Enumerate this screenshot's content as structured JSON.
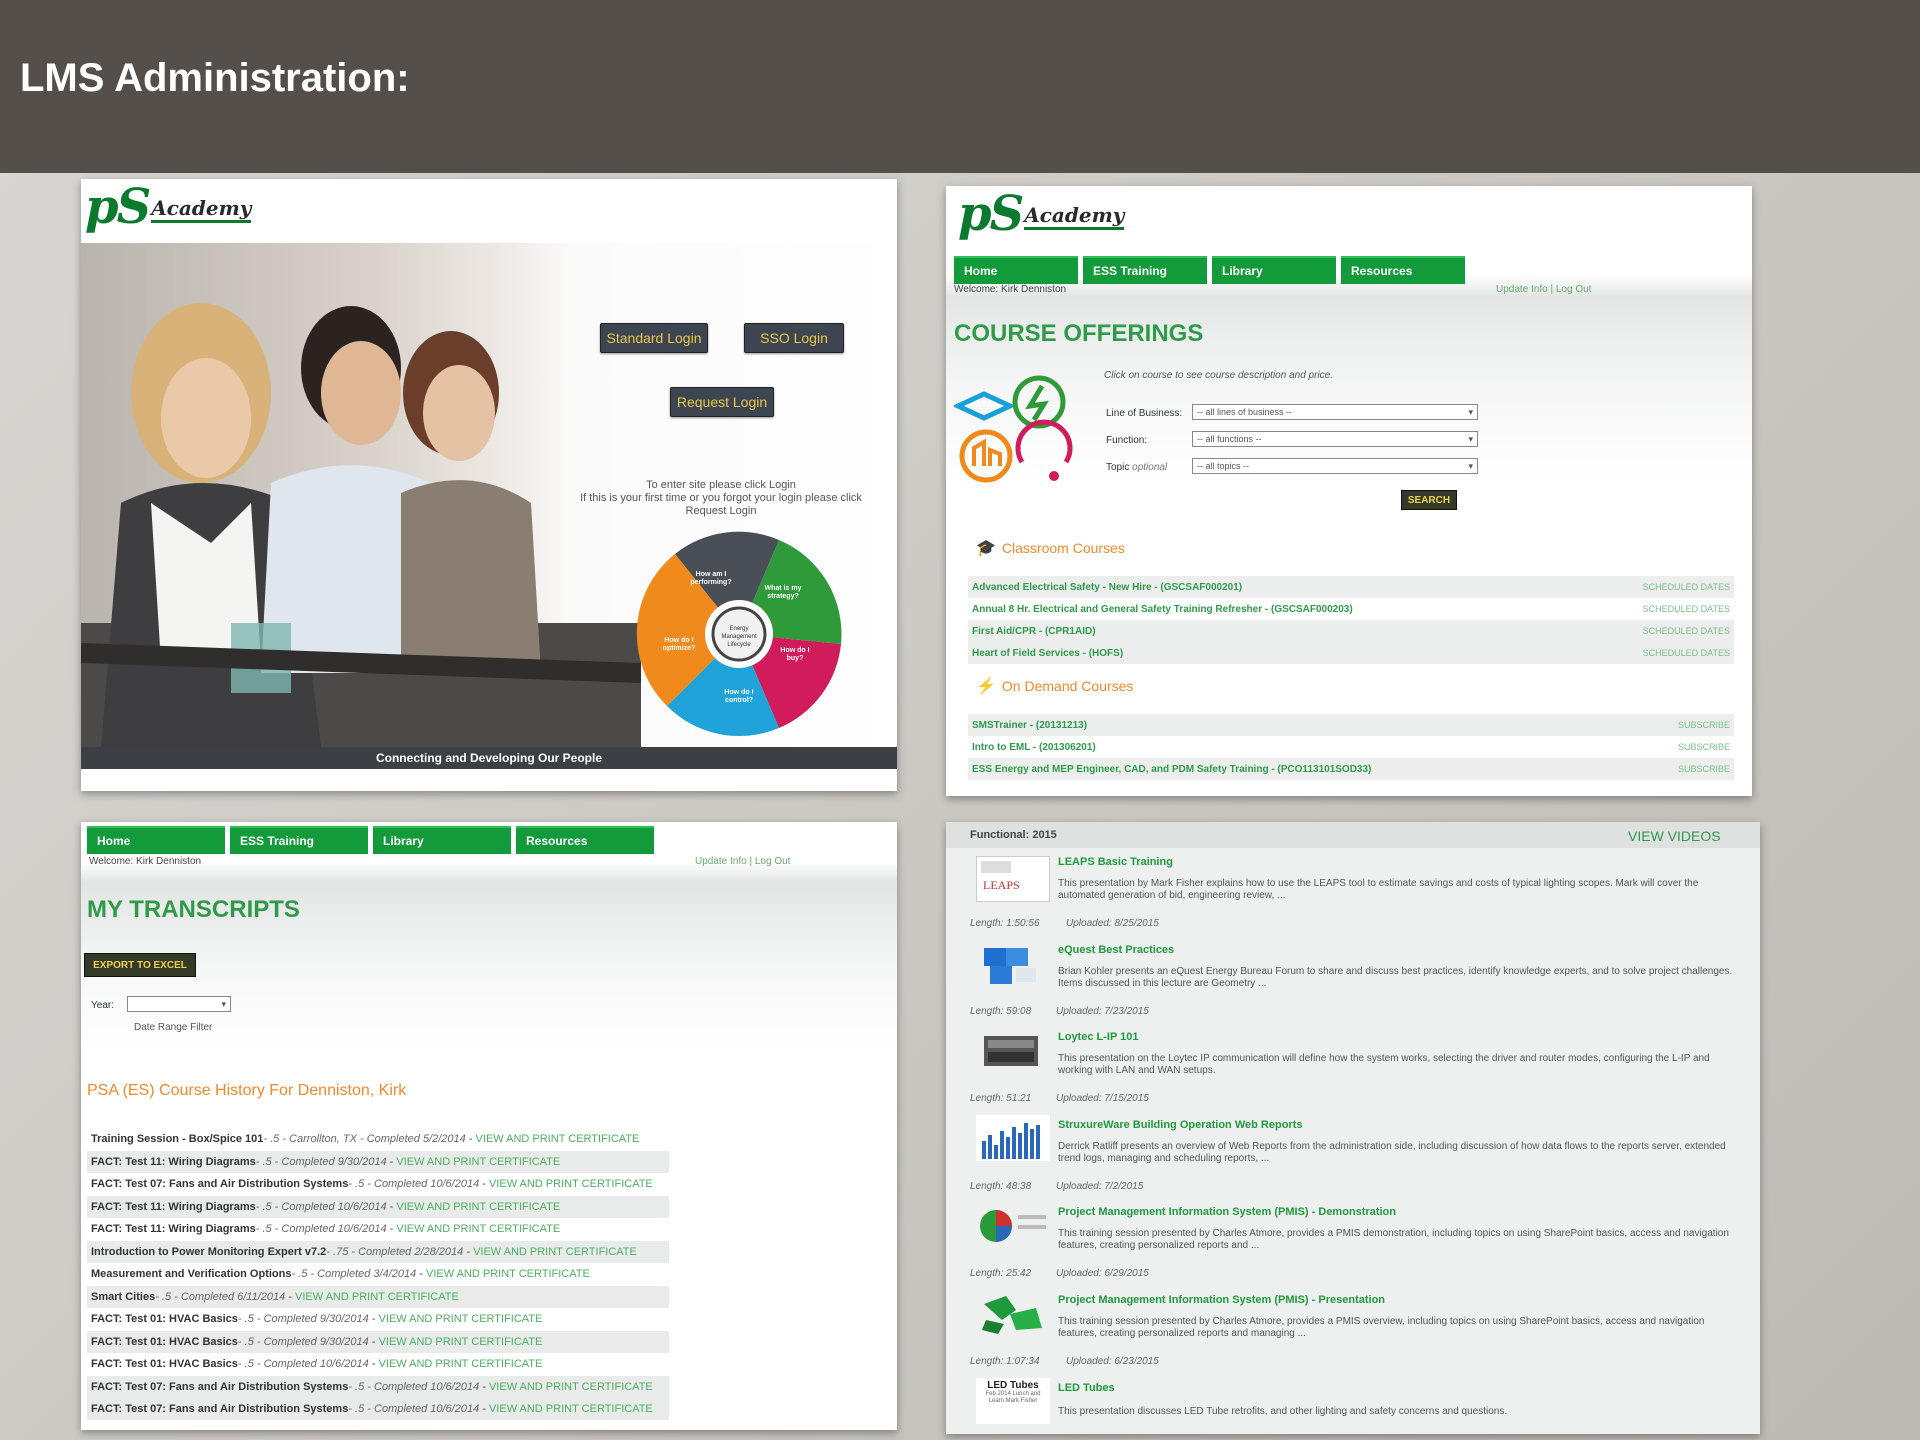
{
  "slide": {
    "title": "LMS Administration:"
  },
  "brand": {
    "ps": "pS",
    "academy": "Academy"
  },
  "login": {
    "standard": "Standard Login",
    "sso": "SSO Login",
    "request": "Request Login",
    "msg1": "To enter site please click Login",
    "msg2": "If this is your first time or you forgot your login please click",
    "msg3": "Request Login",
    "wheel": {
      "center": "Energy Management Lifecycle",
      "q1": "How am I performing?",
      "q2": "What is my strategy?",
      "q3": "How do I buy?",
      "q4": "How do I control?",
      "q5": "How do I optimize?"
    },
    "footer": "Connecting and Developing Our People"
  },
  "nav": {
    "home": "Home",
    "ess": "ESS Training",
    "library": "Library",
    "resources": "Resources"
  },
  "user": {
    "welcome": "Welcome: Kirk Denniston",
    "links": "Update Info | Log Out"
  },
  "offerings": {
    "title": "COURSE OFFERINGS",
    "hint": "Click on course to see course description and price.",
    "lob_label": "Line of Business:",
    "lob_value": "-- all lines of business --",
    "func_label": "Function:",
    "func_value": "-- all functions --",
    "topic_label": "Topic",
    "topic_opt": "optional",
    "topic_value": "-- all topics --",
    "search": "SEARCH",
    "classroom_title": "Classroom Courses",
    "classroom": [
      {
        "name": "Advanced Electrical Safety - New Hire - (GSCSAF000201)",
        "action": "SCHEDULED DATES"
      },
      {
        "name": "Annual 8 Hr. Electrical and General Safety Training Refresher - (GSCSAF000203)",
        "action": "SCHEDULED DATES"
      },
      {
        "name": "First Aid/CPR - (CPR1AID)",
        "action": "SCHEDULED DATES"
      },
      {
        "name": "Heart of Field Services - (HOFS)",
        "action": "SCHEDULED DATES"
      }
    ],
    "ondemand_title": "On Demand Courses",
    "ondemand": [
      {
        "name": "SMSTrainer - (20131213)",
        "action": "SUBSCRIBE"
      },
      {
        "name": "Intro to EML - (201306201)",
        "action": "SUBSCRIBE"
      },
      {
        "name": "ESS Energy and MEP Engineer, CAD, and PDM Safety Training - (PCO113101SOD33)",
        "action": "SUBSCRIBE"
      }
    ]
  },
  "transcripts": {
    "title": "MY TRANSCRIPTS",
    "export": "EXPORT TO EXCEL",
    "year_label": "Year:",
    "range": "Date Range Filter",
    "history": "PSA (ES) Course History For Denniston, Kirk",
    "rows": [
      {
        "name": "Training Session - Box/Spice 101",
        "meta": " - .5 - Carrollton, TX - Completed 5/2/2014",
        "cert": "VIEW AND PRINT CERTIFICATE"
      },
      {
        "name": "FACT: Test 11: Wiring Diagrams",
        "meta": " - .5 - Completed 9/30/2014",
        "cert": "VIEW AND PRINT CERTIFICATE"
      },
      {
        "name": "FACT: Test 07: Fans and Air Distribution Systems",
        "meta": " - .5 - Completed 10/6/2014",
        "cert": "VIEW AND PRINT CERTIFICATE"
      },
      {
        "name": "FACT: Test 11: Wiring Diagrams",
        "meta": " - .5 - Completed 10/6/2014",
        "cert": "VIEW AND PRINT CERTIFICATE"
      },
      {
        "name": "FACT: Test 11: Wiring Diagrams",
        "meta": " - .5 - Completed 10/6/2014",
        "cert": "VIEW AND PRINT CERTIFICATE"
      },
      {
        "name": "Introduction to Power Monitoring Expert v7.2",
        "meta": " - .75 - Completed 2/28/2014",
        "cert": "VIEW AND PRINT CERTIFICATE"
      },
      {
        "name": "Measurement and Verification Options",
        "meta": " - .5 - Completed 3/4/2014",
        "cert": "VIEW AND PRINT CERTIFICATE"
      },
      {
        "name": "Smart Cities",
        "meta": " - .5 - Completed 6/11/2014",
        "cert": "VIEW AND PRINT CERTIFICATE"
      },
      {
        "name": "FACT: Test 01: HVAC Basics",
        "meta": " - .5 - Completed 9/30/2014",
        "cert": "VIEW AND PRINT CERTIFICATE"
      },
      {
        "name": "FACT: Test 01: HVAC Basics",
        "meta": " - .5 - Completed 9/30/2014",
        "cert": "VIEW AND PRINT CERTIFICATE"
      },
      {
        "name": "FACT: Test 01: HVAC Basics",
        "meta": " - .5 - Completed 10/6/2014",
        "cert": "VIEW AND PRINT CERTIFICATE"
      },
      {
        "name": "FACT: Test 07: Fans and Air Distribution Systems",
        "meta": " - .5 - Completed 10/6/2014",
        "cert": "VIEW AND PRINT CERTIFICATE"
      },
      {
        "name": "FACT: Test 07: Fans and Air Distribution Systems",
        "meta": " - .5 - Completed 10/6/2014",
        "cert": "VIEW AND PRINT CERTIFICATE"
      }
    ]
  },
  "videos": {
    "header": "Functional: 2015",
    "view": "VIEW VIDEOS",
    "items": [
      {
        "title": "LEAPS Basic Training",
        "desc": "This presentation by Mark Fisher explains how to use the LEAPS tool to estimate savings and costs of typical lighting scopes. Mark will cover the automated generation of bid, engineering review, ...",
        "length": "Length: 1:50:56",
        "uploaded": "Uploaded: 8/25/2015",
        "thumb": "leaps-thumbnail"
      },
      {
        "title": "eQuest Best Practices",
        "desc": "Brian Kohler presents an eQuest Energy Bureau Forum to share and discuss best practices, identify knowledge experts, and to solve project challenges. Items discussed in this lecture are Geometry ...",
        "length": "Length: 59:08",
        "uploaded": "Uploaded: 7/23/2015",
        "thumb": "puzzle-thumbnail"
      },
      {
        "title": "Loytec L-IP 101",
        "desc": "This presentation on the Loytec IP communication will define how the system works, selecting the driver and router modes, configuring the L-IP and working with LAN and WAN setups.",
        "length": "Length: 51:21",
        "uploaded": "Uploaded: 7/15/2015",
        "thumb": "device-thumbnail"
      },
      {
        "title": "StruxureWare Building Operation Web Reports",
        "desc": "Derrick Ratliff presents an overview of Web Reports from the administration side, including discussion of how data flows to the reports server, extended trend logs, managing and scheduling reports, ...",
        "length": "Length: 48:38",
        "uploaded": "Uploaded: 7/2/2015",
        "thumb": "chart-thumbnail"
      },
      {
        "title": "Project Management Information System (PMIS) - Demonstration",
        "desc": "This training session presented by Charles Atmore, provides a PMIS demonstration, including topics on using SharePoint basics, access and navigation features, creating personalized reports and ...",
        "length": "Length: 25:42",
        "uploaded": "Uploaded: 6/29/2015",
        "thumb": "pie-thumbnail"
      },
      {
        "title": "Project Management Information System (PMIS) - Presentation",
        "desc": "This training session presented by Charles Atmore, provides a PMIS overview, including topics on using SharePoint basics, access and navigation features, creating personalized reports and managing ...",
        "length": "Length: 1:07:34",
        "uploaded": "Uploaded: 6/23/2015",
        "thumb": "arrows-thumbnail"
      },
      {
        "title": "LED Tubes",
        "desc": "This presentation discusses LED Tube retrofits, and other lighting and safety concerns and questions.",
        "length": "",
        "uploaded": "",
        "thumb": "led-thumbnail",
        "thumb_title": "LED Tubes",
        "thumb_sub": "Feb 2014 Lunch and Learn Mark Fisher"
      }
    ]
  }
}
